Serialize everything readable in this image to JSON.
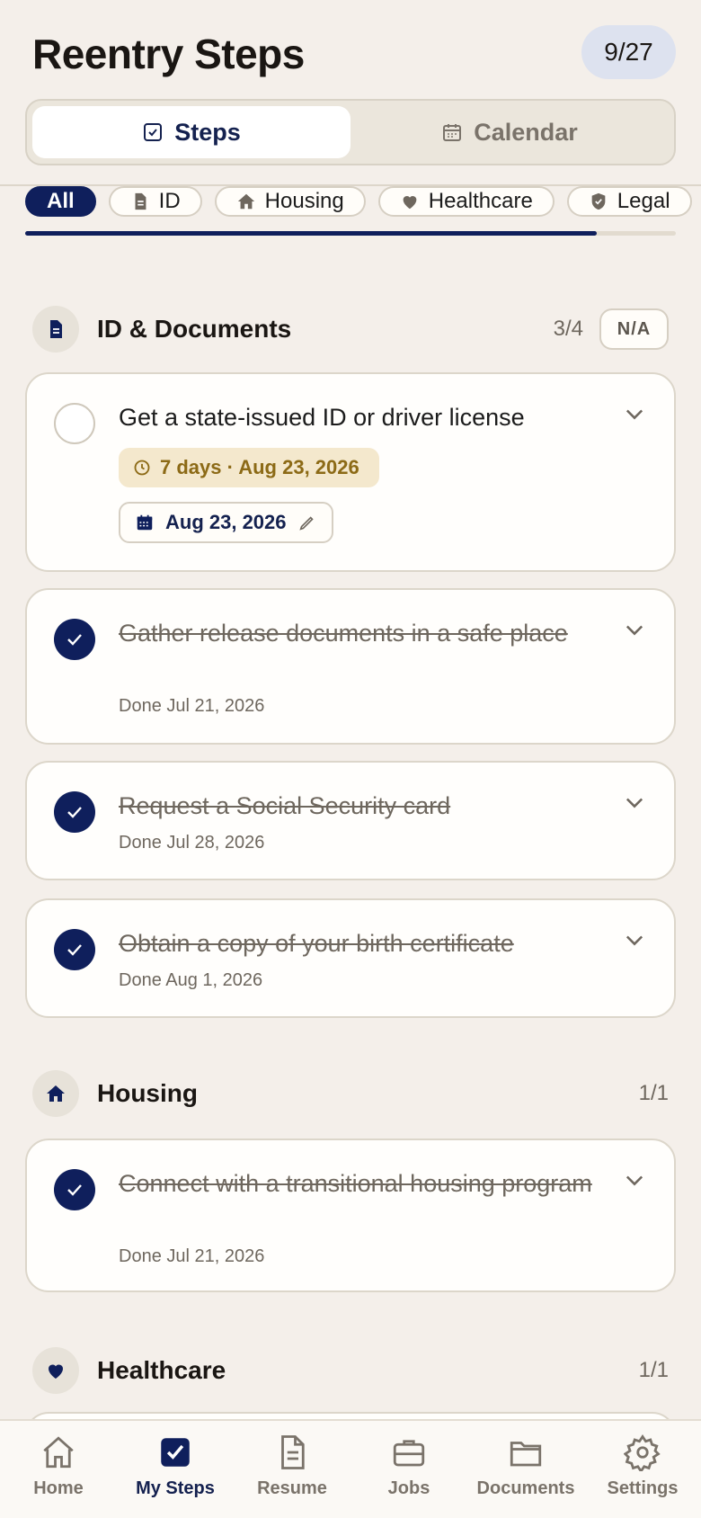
{
  "header": {
    "title": "Reentry Steps",
    "progress": "9/27"
  },
  "tabs": [
    {
      "label": "Steps",
      "active": true
    },
    {
      "label": "Calendar",
      "active": false
    }
  ],
  "filters": [
    {
      "label": "All",
      "active": true
    },
    {
      "label": "ID",
      "icon": "document-icon"
    },
    {
      "label": "Housing",
      "icon": "home-icon"
    },
    {
      "label": "Healthcare",
      "icon": "heart-icon"
    },
    {
      "label": "Legal",
      "icon": "shield-icon"
    }
  ],
  "sections": {
    "id_docs": {
      "title": "ID & Documents",
      "count": "3/4",
      "na_label": "N/A",
      "steps": [
        {
          "title": "Get a state-issued ID or driver license",
          "due": "7 days · Aug 23, 2026",
          "date": "Aug 23, 2026"
        },
        {
          "title": "Gather release documents in a safe place",
          "done": "Done Jul 21, 2026"
        },
        {
          "title": "Request a Social Security card",
          "done": "Done Jul 28, 2026"
        },
        {
          "title": "Obtain a copy of your birth certificate",
          "done": "Done Aug 1, 2026"
        }
      ]
    },
    "housing": {
      "title": "Housing",
      "count": "1/1",
      "steps": [
        {
          "title": "Connect with a transitional housing program",
          "done": "Done Jul 21, 2026"
        }
      ]
    },
    "healthcare": {
      "title": "Healthcare",
      "count": "1/1"
    }
  },
  "nav": [
    {
      "label": "Home",
      "icon": "home-icon"
    },
    {
      "label": "My Steps",
      "icon": "checkbox-icon",
      "active": true
    },
    {
      "label": "Resume",
      "icon": "document-icon"
    },
    {
      "label": "Jobs",
      "icon": "briefcase-icon"
    },
    {
      "label": "Documents",
      "icon": "folder-icon"
    },
    {
      "label": "Settings",
      "icon": "gear-icon"
    }
  ],
  "colors": {
    "navy": "#0f1f5c",
    "background": "#f4efea",
    "due_text": "#8c6a16",
    "due_bg": "#f4e8cd"
  }
}
